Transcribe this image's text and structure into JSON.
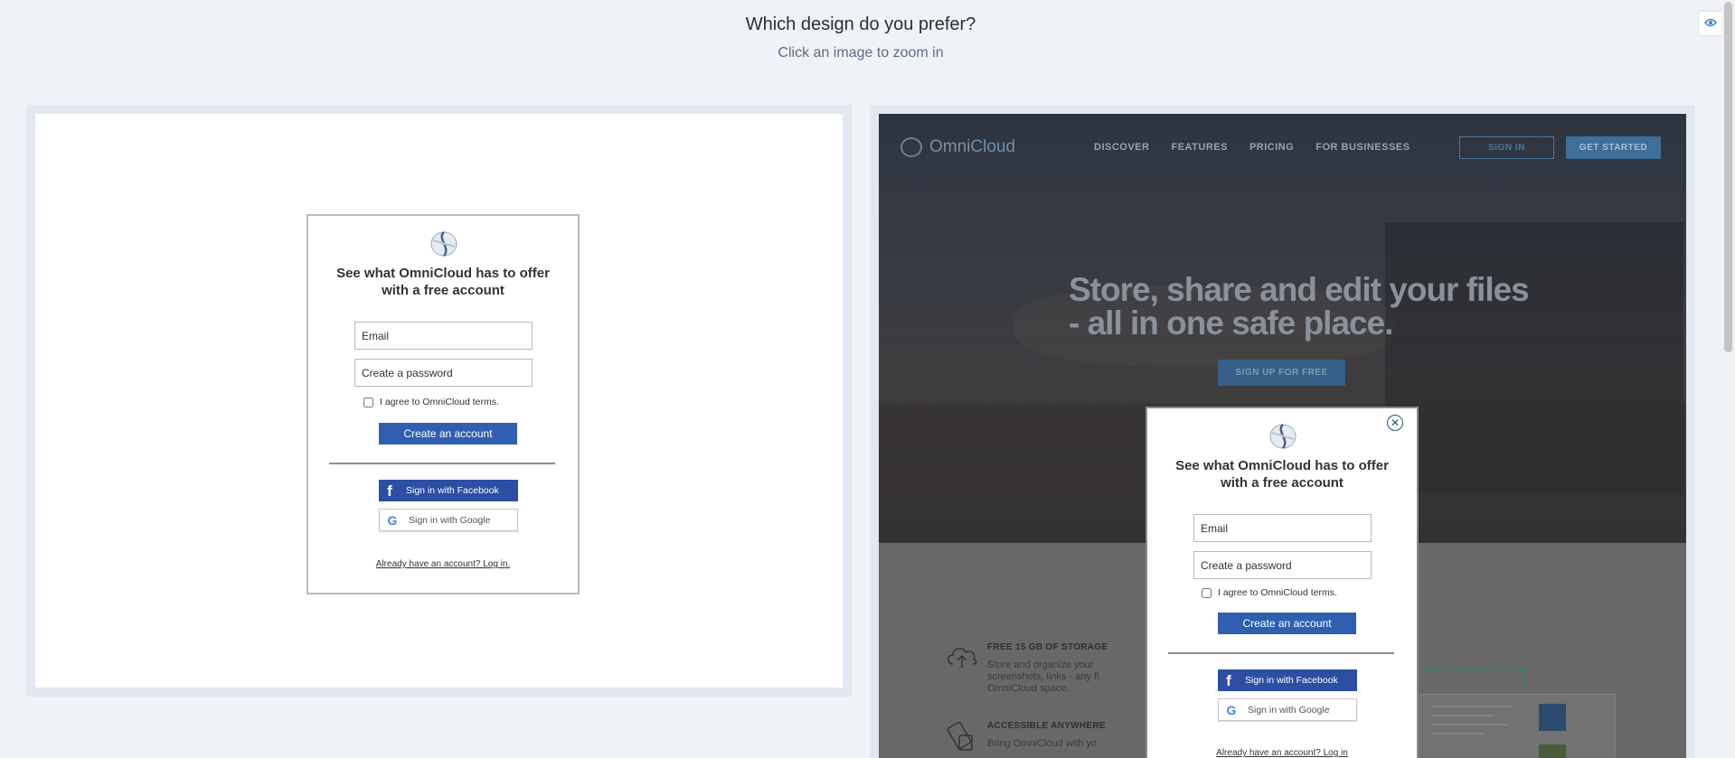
{
  "header": {
    "title": "Which design do you prefer?",
    "subtitle": "Click an image to zoom in"
  },
  "signup": {
    "headline": "See what OmniCloud has to offer with a free account",
    "email_placeholder": "Email",
    "password_placeholder": "Create a password",
    "terms_label": "I agree to OmniCloud terms.",
    "create_label": "Create an account",
    "facebook_label": "Sign in with Facebook",
    "google_label": "Sign in with Google",
    "login_link_a": "Already have an account? Log in.",
    "login_link_b": "Already have an account? Log in"
  },
  "site": {
    "brand_omni": "Omni",
    "brand_cloud": "Cloud",
    "nav": [
      "DISCOVER",
      "FEATURES",
      "PRICING",
      "FOR BUSINESSES"
    ],
    "sign_in": "SIGN IN",
    "get_started": "GET STARTED",
    "hero_heading": "Store, share and edit your files - all in one safe place.",
    "hero_cta": "SIGN UP FOR FREE",
    "features": [
      {
        "title": "FREE 15 GB OF STORAGE",
        "text": "Store and organize your screenshots, links - any fi OmniCloud space."
      },
      {
        "title": "ACCESSIBLE ANYWHERE",
        "text": "Bring OmniCloud with yo"
      }
    ]
  },
  "colors": {
    "primary_button": "#2f5fb0",
    "facebook": "#2c4fa3",
    "page_bg": "#eff2f7"
  },
  "icons": {
    "eye": "eye-icon",
    "close": "close-icon",
    "facebook": "facebook-icon",
    "google": "google-icon",
    "logo": "omnicloud-logo-icon"
  }
}
